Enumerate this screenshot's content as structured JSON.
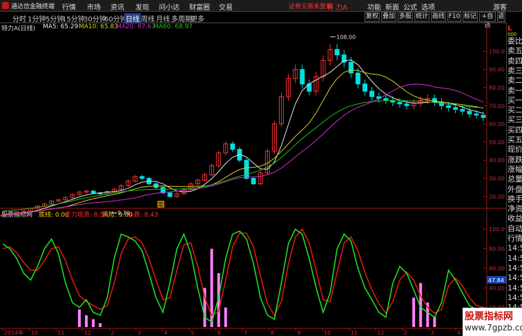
{
  "app": {
    "title": "通达信金融终端"
  },
  "menu": [
    "行情",
    "市场",
    "资讯",
    "发现",
    "问小达",
    "财富圈",
    "交易"
  ],
  "login_status": "证券交易未登录",
  "stock_name": "特 力A",
  "right_menu": [
    "功能",
    "新面",
    "公式",
    "选项",
    "游客"
  ],
  "periods": [
    "分时",
    "1分钟",
    "5分钟",
    "15分钟",
    "30分钟",
    "60分钟",
    "日线",
    "周线",
    "月线",
    "多周期",
    "更多"
  ],
  "active_period": "日线",
  "toolbar": [
    "复权",
    "叠加",
    "多股",
    "统计",
    "画线",
    "F10",
    "标记",
    "+自选",
    "返回"
  ],
  "info": {
    "title": "特力A(日线)",
    "ma5": "MA5: 65.29",
    "ma10": "MA10: 65.83",
    "ma20": "MA20: 67.67",
    "ma60": "MA60: 68.97"
  },
  "indicator": {
    "name": "股票指标网",
    "bottom": "底线: 0.00",
    "main": "主力吸货: 8.59",
    "risk": "风险: 9.00",
    "fall": "杀跌: 8.43"
  },
  "right_panel": [
    "委比",
    "卖五",
    "卖四",
    "卖三",
    "卖二",
    "卖一",
    "买一",
    "买二",
    "买三",
    "买四",
    "买五",
    "现价",
    "涨跌",
    "涨幅",
    "总量",
    "外盘",
    "换手",
    "净资",
    "收益",
    "自动",
    "行情",
    "14:5",
    "14:5",
    "14:5",
    "14:5",
    "14:5",
    "14:5",
    "14:5",
    "14:5",
    "14:5"
  ],
  "right_header": "L",
  "right_header_sub": "000",
  "price_labels": {
    "high": "108.00",
    "low": "9.70"
  },
  "price_axis": [
    "100.0",
    "90.00",
    "80.00",
    "70.00",
    "60.00",
    "50.00",
    "40.00",
    "30.00",
    "20.00"
  ],
  "ind_axis": [
    "100.0",
    "80.00",
    "60.00",
    "40.00",
    "20.00"
  ],
  "ind_axis_current": "47.84",
  "date_axis": [
    "2014年",
    "10",
    "11",
    "12",
    "2",
    "3",
    "4",
    "5",
    "6",
    "7",
    "8",
    "9",
    "10",
    "11",
    "12",
    "2",
    "3",
    "4"
  ],
  "event_marker": "定",
  "watermark": {
    "line1": "股票指标网",
    "line2": "www.7gpzb.com"
  },
  "colors": {
    "ma5": "#e8e8e8",
    "ma10": "#e0d020",
    "ma20": "#d030d0",
    "ma60": "#20c020",
    "up": "#ff3030",
    "down": "#00e0e0",
    "ind_green": "#20e020",
    "ind_red": "#e01818",
    "ind_bar": "#ff80ff"
  },
  "chart_data": {
    "type": "line",
    "main_price": {
      "description_series": "close",
      "values": [
        9.7,
        10.5,
        11.2,
        12.0,
        13.5,
        14.8,
        16.0,
        17.5,
        18.2,
        19.5,
        21.0,
        22.5,
        23.0,
        22.0,
        21.5,
        22.8,
        24.0,
        26.0,
        28.5,
        31.0,
        30.0,
        27.0,
        25.0,
        22.0,
        20.0,
        21.5,
        24.0,
        27.0,
        29.0,
        32.0,
        37.0,
        44.0,
        49.0,
        46.0,
        40.0,
        30.0,
        27.0,
        33.0,
        45.0,
        60.0,
        75.0,
        85.0,
        90.0,
        82.0,
        78.0,
        86.0,
        95.0,
        101.0,
        98.0,
        94.0,
        88.0,
        82.0,
        78.0,
        75.0,
        74.0,
        73.0,
        72.0,
        71.0,
        70.0,
        71.5,
        73.0,
        74.0,
        72.0,
        70.0,
        69.0,
        68.0,
        67.0,
        65.5,
        64.8,
        63.5
      ],
      "ylim": [
        15,
        110
      ]
    },
    "ma60": [
      12,
      12.3,
      12.6,
      13.0,
      13.5,
      14.0,
      14.6,
      15.3,
      16.0,
      16.8,
      17.6,
      18.5,
      19.3,
      20.0,
      20.7,
      21.4,
      22.0,
      22.5,
      23.0,
      23.4,
      23.7,
      23.9,
      24.0,
      24.0,
      24.0,
      24.1,
      24.3,
      24.6,
      25.0,
      25.6,
      26.4,
      27.5,
      28.8,
      30.0,
      31.2,
      32.2,
      33.2,
      34.5,
      36.2,
      38.5,
      41.5,
      45.0,
      48.5,
      52.0,
      55.0,
      58.0,
      61.0,
      64.0,
      66.5,
      68.5,
      70.0,
      71.0,
      71.8,
      72.3,
      72.6,
      72.8,
      72.9,
      72.9,
      72.8,
      72.6,
      72.4,
      72.2,
      71.8,
      71.3,
      70.8,
      70.3,
      69.8,
      69.4,
      69.1,
      68.97
    ],
    "indicator": {
      "green": [
        85,
        80,
        70,
        55,
        48,
        62,
        80,
        90,
        75,
        45,
        25,
        20,
        28,
        15,
        12,
        30,
        70,
        95,
        92,
        88,
        78,
        55,
        30,
        15,
        45,
        80,
        95,
        75,
        40,
        10,
        5,
        30,
        70,
        95,
        98,
        90,
        65,
        30,
        12,
        8,
        45,
        85,
        100,
        95,
        70,
        40,
        15,
        35,
        80,
        95,
        88,
        60,
        40,
        28,
        15,
        10,
        45,
        62,
        55,
        38,
        20,
        15,
        10,
        25,
        58,
        48,
        35,
        22,
        18,
        20
      ],
      "red": [
        80,
        82,
        76,
        66,
        58,
        58,
        68,
        80,
        82,
        68,
        48,
        32,
        26,
        22,
        18,
        22,
        45,
        75,
        90,
        92,
        86,
        70,
        48,
        28,
        30,
        58,
        84,
        86,
        62,
        30,
        12,
        16,
        48,
        82,
        96,
        96,
        82,
        52,
        24,
        12,
        26,
        64,
        92,
        100,
        86,
        58,
        28,
        26,
        56,
        86,
        92,
        78,
        56,
        38,
        24,
        14,
        26,
        48,
        56,
        48,
        32,
        20,
        14,
        18,
        42,
        50,
        42,
        30,
        22,
        20
      ],
      "bars": [
        0,
        0,
        0,
        0,
        0,
        0,
        0,
        0,
        0,
        0,
        0,
        18,
        12,
        8,
        4,
        0,
        0,
        0,
        0,
        0,
        0,
        0,
        0,
        0,
        0,
        0,
        0,
        0,
        0,
        40,
        80,
        55,
        20,
        0,
        0,
        0,
        0,
        0,
        0,
        0,
        0,
        0,
        0,
        0,
        0,
        0,
        0,
        0,
        0,
        0,
        0,
        0,
        0,
        0,
        0,
        0,
        0,
        0,
        0,
        30,
        45,
        25,
        10,
        0,
        0,
        0,
        0,
        0,
        0,
        0
      ],
      "ylim": [
        0,
        110
      ]
    }
  }
}
